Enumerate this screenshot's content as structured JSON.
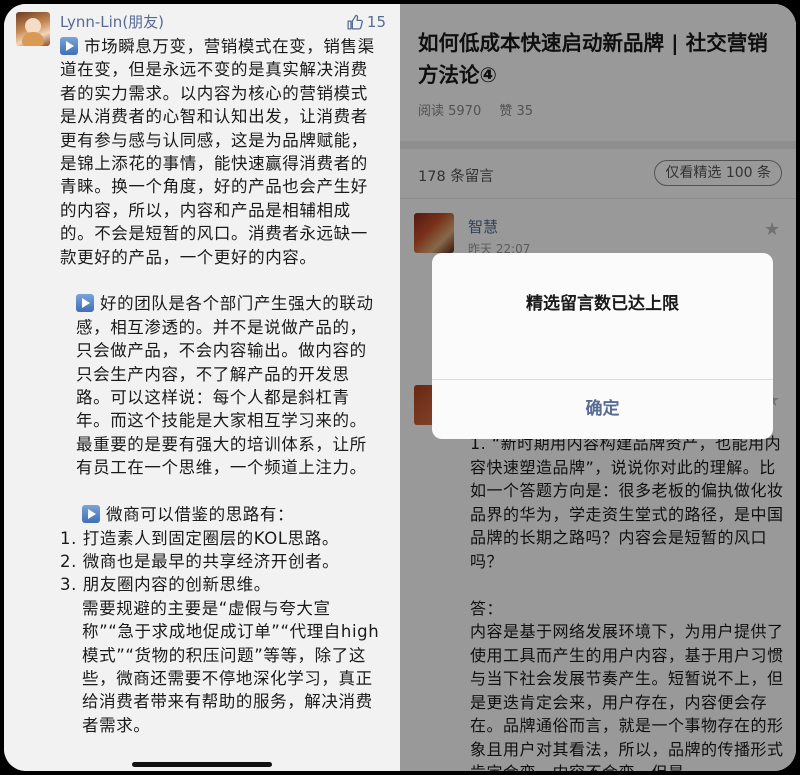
{
  "left_comment": {
    "username": "Lynn-Lin(朋友)",
    "like_count": "15",
    "paragraphs": [
      {
        "icon": true,
        "text": "市场瞬息万变，营销模式在变，销售渠道在变，但是永远不变的是真实解决消费者的实力需求。以内容为核心的营销模式是从消费者的心智和认知出发，让消费者更有参与感与认同感，这是为品牌赋能，是锦上添花的事情，能快速赢得消费者的青睐。换一个角度，好的产品也会产生好的内容，所以，内容和产品是相辅相成的。不会是短暂的风口。消费者永远缺一款更好的产品，一个更好的内容。"
      },
      {
        "icon": true,
        "indent": 1,
        "text": "好的团队是各个部门产生强大的联动感，相互渗透的。并不是说做产品的，只会做产品，不会内容输出。做内容的只会生产内容，不了解产品的开发思路。可以这样说：每个人都是斜杠青年。而这个技能是大家相互学习来的。最重要的是要有强大的培训体系，让所有员工在一个思维，一个频道上注力。"
      },
      {
        "icon": true,
        "indent": 2,
        "text": "微商可以借鉴的思路有："
      }
    ],
    "list_items": [
      "1. 打造素人到固定圈层的KOL思路。",
      "2. 微商也是最早的共享经济开创者。",
      "3. 朋友圈内容的创新思维。"
    ],
    "closing": "需要规避的主要是“虚假与夸大宣称”“急于求成地促成订单”“代理自high模式”“货物的积压问题”等等，除了这些，微商还需要不停地深化学习，真正给消费者带来有帮助的服务，解决消费者需求。"
  },
  "article": {
    "title": "如何低成本快速启动新品牌 | 社交营销方法论④",
    "reads": "阅读 5970",
    "likes": "赞 35"
  },
  "comments_header": {
    "count": "178 条留言",
    "filter": "仅看精选 100 条"
  },
  "first_comment": {
    "name": "智慧",
    "time": "昨天 22:07"
  },
  "reply": {
    "question_first_line": "1.  “新时期用内容构建品牌资产，也能用内容快速塑造品牌”，说说你对此的理解。比如一个答题方向是：很多老板的偏执做化妆品界的华为，学走资生堂式的路径，是中国品牌的长期之路吗？内容会是短暂的风口吗？",
    "answer_label": "答：",
    "answer_text": "内容是基于网络发展环境下，为用户提供了使用工具而产生的用户内容，基于用户习惯与当下社会发展节奏产生。短暂说不上，但是更迭肯定会来，用户存在，内容便会存在。品牌通俗而言，就是一个事物存在的形象且用户对其看法，所以，品牌的传播形式肯定会变，内容不会变，但是"
  },
  "dialog": {
    "message": "精选留言数已达上限",
    "confirm": "确定"
  },
  "colors": {
    "link_blue": "#576b95",
    "overlay": "rgba(0,0,0,0.4)"
  }
}
